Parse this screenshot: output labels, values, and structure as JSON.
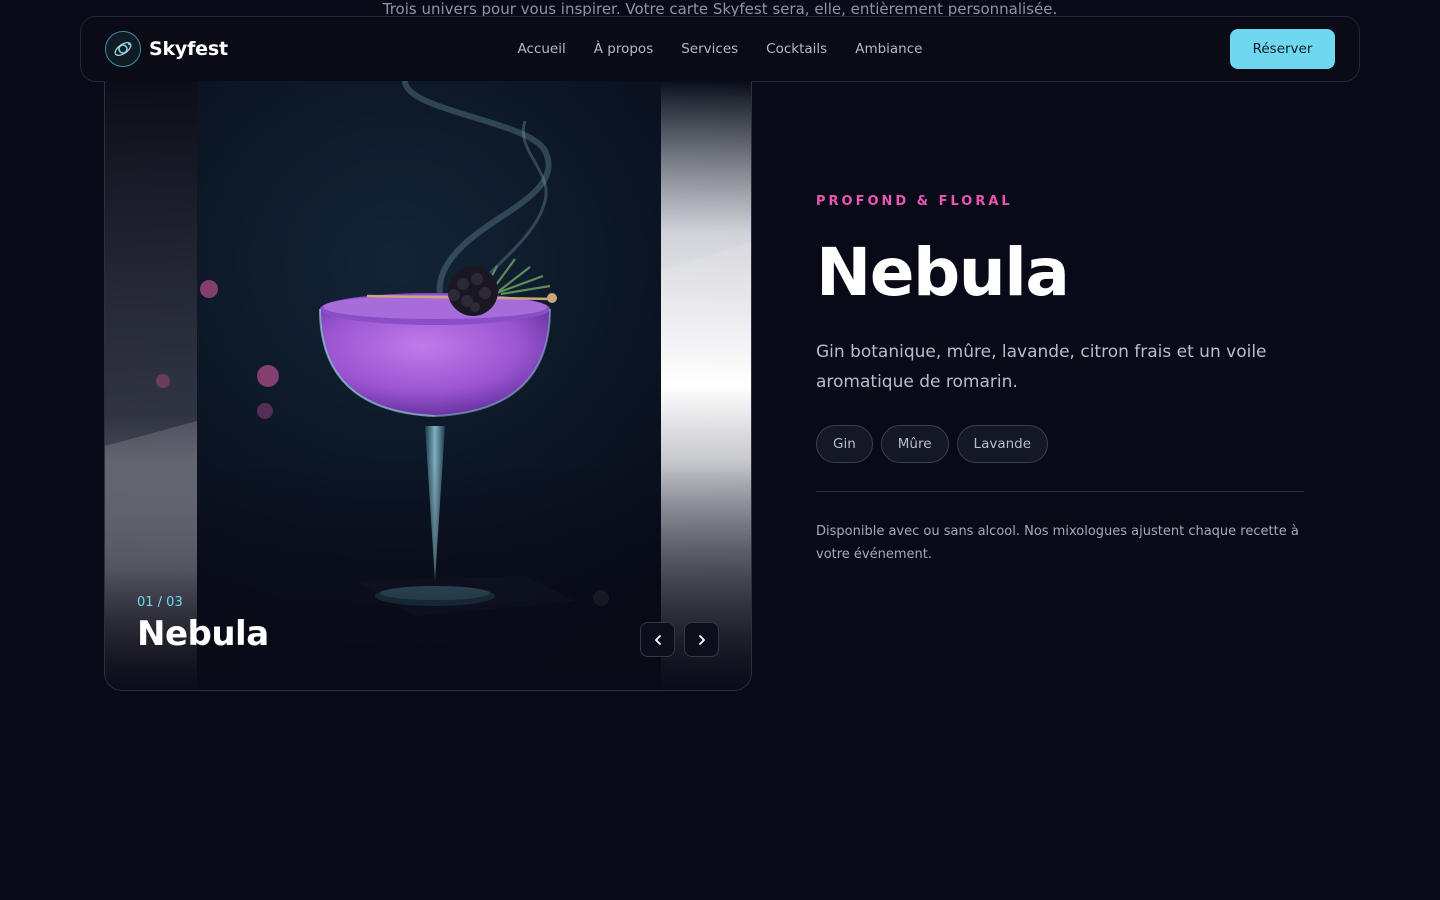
{
  "intro_text": "Trois univers pour vous inspirer. Votre carte Skyfest sera, elle, entièrement personnalisée.",
  "brand": {
    "name": "Skyfest",
    "icon": "orbit-logo-icon"
  },
  "nav": {
    "links": [
      "Accueil",
      "À propos",
      "Services",
      "Cocktails",
      "Ambiance"
    ],
    "cta_label": "Réserver"
  },
  "carousel": {
    "counter": "01 / 03",
    "title": "Nebula",
    "image": "purple-cocktail-coupe-with-blackberry-and-rosemary-garnish-and-smoke",
    "prev_icon": "chevron-left-icon",
    "next_icon": "chevron-right-icon"
  },
  "detail": {
    "eyebrow": "PROFOND & FLORAL",
    "title": "Nebula",
    "description": "Gin botanique, mûre, lavande, citron frais et un voile aromatique de romarin.",
    "tags": [
      "Gin",
      "Mûre",
      "Lavande"
    ],
    "note": "Disponible avec ou sans alcool. Nos mixologues ajustent chaque recette à votre événement."
  },
  "colors": {
    "background": "#090a17",
    "accent_cyan": "#6fd8ef",
    "accent_pink": "#e956b1",
    "drink_purple": "#a05fd6"
  }
}
